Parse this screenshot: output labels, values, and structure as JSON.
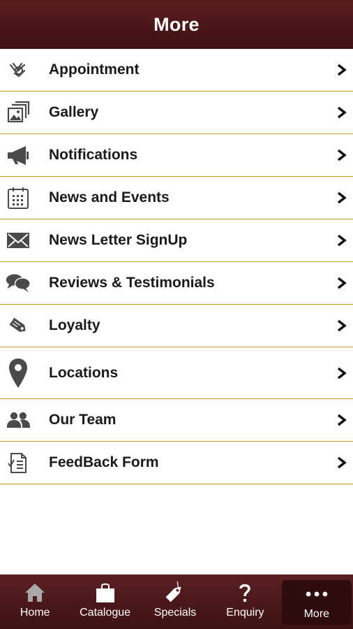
{
  "header": {
    "title": "More"
  },
  "menu": [
    {
      "label": "Appointment",
      "icon": "appointment-icon"
    },
    {
      "label": "Gallery",
      "icon": "gallery-icon"
    },
    {
      "label": "Notifications",
      "icon": "megaphone-icon"
    },
    {
      "label": "News and Events",
      "icon": "calendar-icon"
    },
    {
      "label": "News Letter SignUp",
      "icon": "envelope-icon"
    },
    {
      "label": "Reviews & Testimonials",
      "icon": "chat-bubbles-icon"
    },
    {
      "label": "Loyalty",
      "icon": "tag-icon"
    },
    {
      "label": "Locations",
      "icon": "map-pin-icon"
    },
    {
      "label": "Our Team",
      "icon": "people-icon"
    },
    {
      "label": "FeedBack Form",
      "icon": "feedback-form-icon"
    }
  ],
  "tabs": [
    {
      "label": "Home",
      "icon": "home-icon"
    },
    {
      "label": "Catalogue",
      "icon": "bag-icon"
    },
    {
      "label": "Specials",
      "icon": "price-tag-icon"
    },
    {
      "label": "Enquiry",
      "icon": "question-icon"
    },
    {
      "label": "More",
      "icon": "more-dots-icon",
      "active": true
    }
  ],
  "colors": {
    "header_bg": "#4a1618",
    "divider": "#d4a030",
    "icon": "#4a4a4a",
    "tab_active_bg": "#2f0c0e"
  }
}
